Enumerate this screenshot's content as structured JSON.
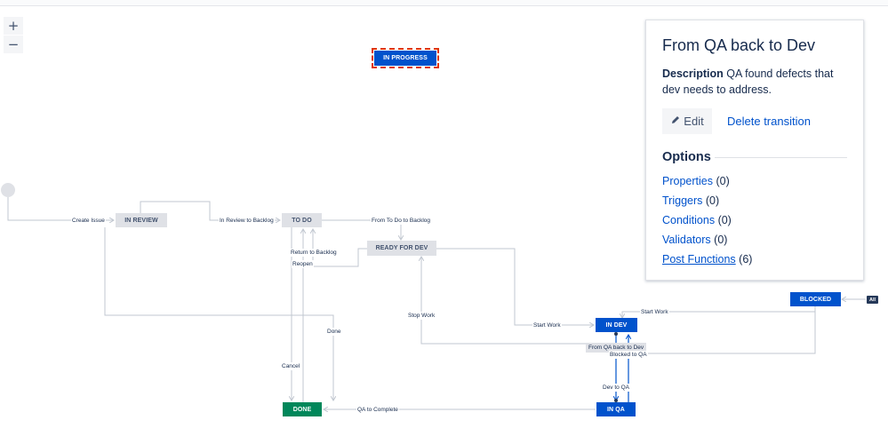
{
  "zoom": {
    "in_label": "+",
    "out_label": "−"
  },
  "nodes": {
    "in_progress": "IN PROGRESS",
    "in_review": "IN REVIEW",
    "to_do": "TO DO",
    "ready_for_dev": "READY FOR DEV",
    "blocked": "BLOCKED",
    "in_dev": "IN DEV",
    "done": "DONE",
    "in_qa": "IN QA"
  },
  "all_badge": "All",
  "transitions": {
    "create_issue": "Create Issue",
    "in_review_to_backlog": "In Review to Backlog",
    "from_todo_to_backlog": "From To Do to Backlog",
    "return_to_backlog": "Return to Backlog",
    "reopen": "Reopen",
    "stop_work": "Stop Work",
    "done": "Done",
    "start_work_dev": "Start Work",
    "start_work_blocked": "Start Work",
    "from_qa_back_to_dev": "From QA back to Dev",
    "blocked_to_qa": "Blocked to QA",
    "cancel": "Cancel",
    "dev_to_qa": "Dev to QA",
    "qa_to_complete": "QA to Complete"
  },
  "panel": {
    "title": "From QA back to Dev",
    "description_label": "Description",
    "description_text": "QA found defects that dev needs to address.",
    "edit_label": "Edit",
    "delete_label": "Delete transition",
    "options_heading": "Options",
    "options": [
      {
        "label": "Properties",
        "count": "(0)"
      },
      {
        "label": "Triggers",
        "count": "(0)"
      },
      {
        "label": "Conditions",
        "count": "(0)"
      },
      {
        "label": "Validators",
        "count": "(0)"
      },
      {
        "label": "Post Functions",
        "count": "(6)"
      }
    ]
  },
  "colors": {
    "status_todo": "#dfe1e6",
    "status_in_progress": "#0052cc",
    "status_done": "#00875a",
    "selected_outline": "#de350b",
    "link": "#0052cc",
    "line": "#c1c7d0"
  },
  "icons": {
    "edit": "pencil-icon",
    "start": "start-circle-icon"
  }
}
